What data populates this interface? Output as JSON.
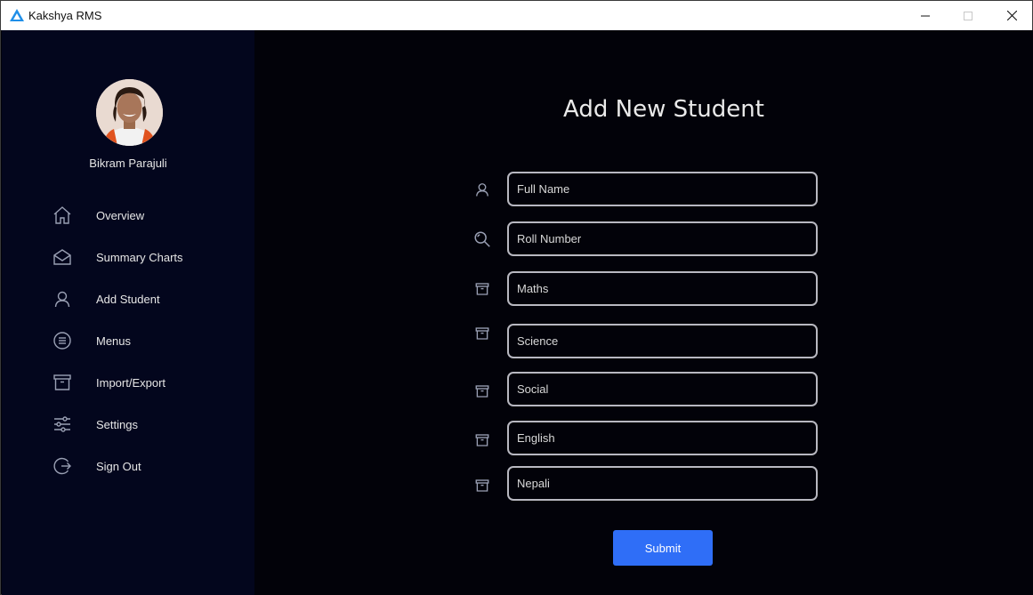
{
  "window": {
    "title": "Kakshya RMS",
    "accent": "#2f6ef7"
  },
  "sidebar": {
    "user_name": "Bikram Parajuli",
    "items": [
      {
        "label": "Overview",
        "icon": "home-icon"
      },
      {
        "label": "Summary Charts",
        "icon": "envelope-icon"
      },
      {
        "label": "Add Student",
        "icon": "user-icon"
      },
      {
        "label": "Menus",
        "icon": "list-circle-icon"
      },
      {
        "label": "Import/Export",
        "icon": "archive-icon"
      },
      {
        "label": "Settings",
        "icon": "sliders-icon"
      },
      {
        "label": "Sign Out",
        "icon": "sign-out-icon"
      }
    ]
  },
  "main": {
    "title": "Add New Student",
    "fields": [
      {
        "placeholder": "Full Name",
        "icon": "user-icon"
      },
      {
        "placeholder": "Roll Number",
        "icon": "search-icon"
      },
      {
        "placeholder": "Maths",
        "icon": "archive-icon"
      },
      {
        "placeholder": "Science",
        "icon": "archive-icon"
      },
      {
        "placeholder": "Social",
        "icon": "archive-icon"
      },
      {
        "placeholder": "English",
        "icon": "archive-icon"
      },
      {
        "placeholder": "Nepali",
        "icon": "archive-icon"
      }
    ],
    "submit_label": "Submit"
  }
}
